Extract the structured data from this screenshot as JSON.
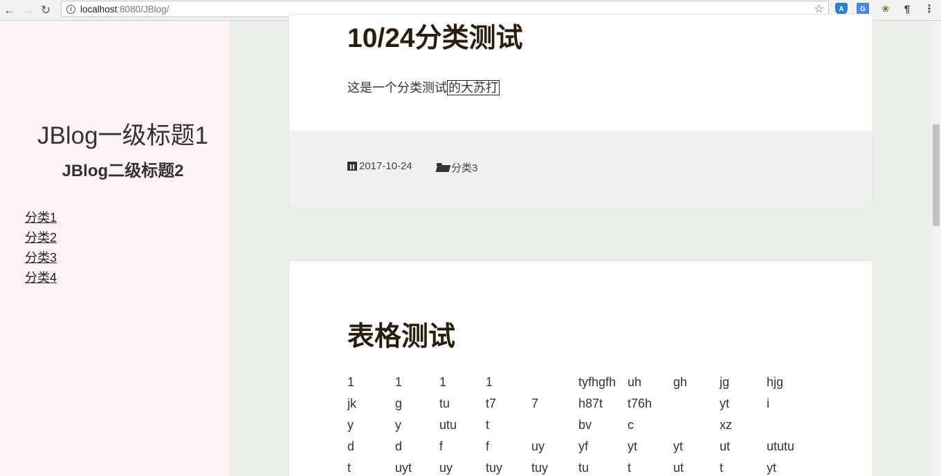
{
  "browser": {
    "url_host": "localhost",
    "url_rest": ":8080/JBlog/"
  },
  "sidebar": {
    "title": "JBlog一级标题1",
    "subtitle": "JBlog二级标题2",
    "categories": [
      "分类1",
      "分类2",
      "分类3",
      "分类4"
    ]
  },
  "posts": [
    {
      "title": "10/24分类测试",
      "excerpt_plain": "这是一个分类测试",
      "excerpt_boxed": "的大苏打",
      "date": "2017-10-24",
      "category": "分类3"
    },
    {
      "title": "表格测试",
      "table": [
        [
          "1",
          "1",
          "1",
          "1",
          "",
          "tyfhgfh",
          "uh",
          "gh",
          "jg",
          "hjg"
        ],
        [
          "jk",
          "g",
          "tu",
          "t7",
          "7",
          "h87t",
          "t76h",
          "",
          "yt",
          "i"
        ],
        [
          "y",
          "y",
          "utu",
          "t",
          "",
          "bv",
          "c",
          "",
          "xz",
          ""
        ],
        [
          "d",
          "d",
          "f",
          "f",
          "uy",
          "yf",
          "yt",
          "yt",
          "ut",
          "ututu"
        ],
        [
          "t",
          "uyt",
          "uy",
          "tuy",
          "tuy",
          "tu",
          "t",
          "ut",
          "t",
          "yt"
        ]
      ]
    }
  ]
}
